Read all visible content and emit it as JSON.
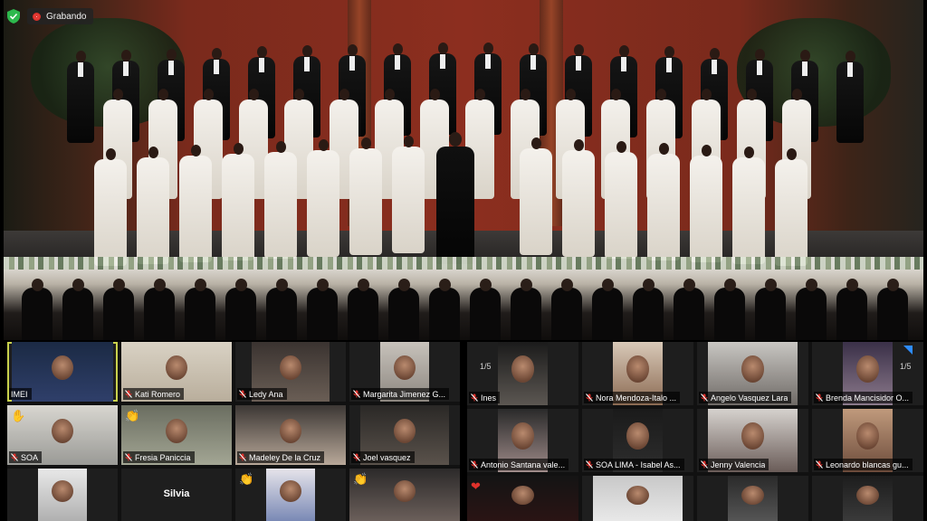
{
  "app": {
    "recording_label": "Grabando",
    "colors": {
      "recording": "#e0312b",
      "shield": "#2db84d",
      "active_speaker": "#c9d24d",
      "pager_arrow": "#2d8cff"
    }
  },
  "left_panel": {
    "tiles": [
      {
        "name": "IMEI",
        "muted": false,
        "active": true
      },
      {
        "name": "Kati Romero",
        "muted": true
      },
      {
        "name": "Ledy Ana",
        "muted": true
      },
      {
        "name": "Margarita Jimenez G...",
        "muted": true
      },
      {
        "name": "SOA",
        "muted": true,
        "reaction": "raised-hand-icon"
      },
      {
        "name": "Fresia Paniccia",
        "muted": true,
        "reaction": "clap-icon"
      },
      {
        "name": "Madeley De la Cruz",
        "muted": true
      },
      {
        "name": "Joel vasquez",
        "muted": true
      },
      {
        "name": "",
        "muted": false
      },
      {
        "name": "Silvia",
        "muted": false
      },
      {
        "name": "",
        "muted": false,
        "reaction": "clap-icon"
      },
      {
        "name": "",
        "muted": false,
        "reaction": "clap-icon"
      }
    ]
  },
  "right_panel": {
    "page_left": "1/5",
    "page_right": "1/5",
    "tiles": [
      {
        "name": "Ines",
        "muted": true
      },
      {
        "name": "Nora Mendoza-Italo ...",
        "muted": true
      },
      {
        "name": "Angelo Vasquez Lara",
        "muted": true
      },
      {
        "name": "Brenda Mancisidor O...",
        "muted": true
      },
      {
        "name": "Antonio Santana vale...",
        "muted": true
      },
      {
        "name": "SOA LIMA - Isabel As...",
        "muted": true
      },
      {
        "name": "Jenny Valencia",
        "muted": true
      },
      {
        "name": "Leonardo blancas gu...",
        "muted": true
      },
      {
        "name": "",
        "muted": false,
        "reaction": "heart-icon"
      },
      {
        "name": "",
        "muted": false
      },
      {
        "name": "",
        "muted": false
      },
      {
        "name": "",
        "muted": false
      }
    ]
  }
}
